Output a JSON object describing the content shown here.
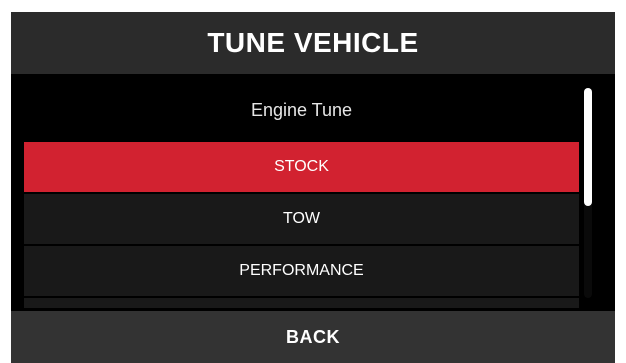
{
  "header": {
    "title": "TUNE VEHICLE"
  },
  "list": {
    "title": "Engine Tune",
    "options": [
      {
        "label": "STOCK",
        "selected": true
      },
      {
        "label": "TOW",
        "selected": false
      },
      {
        "label": "PERFORMANCE",
        "selected": false
      }
    ]
  },
  "footer": {
    "back_label": "BACK"
  },
  "colors": {
    "accent": "#d22230",
    "background": "#000000",
    "header_bg": "#2b2b2b",
    "row_bg": "#191919",
    "footer_bg": "#333333",
    "text": "#ffffff"
  }
}
